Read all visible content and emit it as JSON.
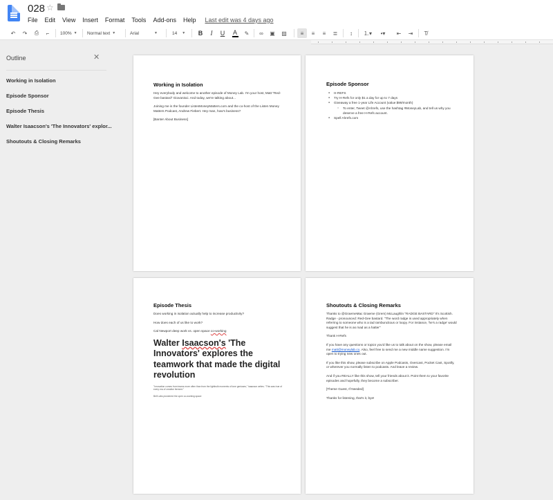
{
  "doc": {
    "title": "028",
    "star_icon": "star-icon",
    "folder_icon": "folder-icon"
  },
  "menu": {
    "items": [
      "File",
      "Edit",
      "View",
      "Insert",
      "Format",
      "Tools",
      "Add-ons",
      "Help"
    ],
    "last_edit": "Last edit was 4 days ago"
  },
  "toolbar": {
    "zoom": "100%",
    "style": "Normal text",
    "font": "Arial",
    "font_size": "14",
    "bold": "B",
    "italic": "I",
    "underline": "U",
    "text_color": "A"
  },
  "outline": {
    "title": "Outline",
    "items": [
      "Working in Isolation",
      "Episode Sponsor",
      "Episode Thesis",
      "Walter Isaacson's 'The Innovators' explor...",
      "Shoutouts & Closing Remarks"
    ]
  },
  "pages": {
    "p1": {
      "heading": "Working in Isolation",
      "para1": "Hey everybody and welcome to another episode of Money Lab. I'm your host, Matt \"Red-Gee bastard\" Giovanisci. And today, we're talking about...",
      "para2": "Joining me is the founder ListenMoneyMatters.com and the co-host of the Listen Money Matters Podcast, Andrew Fiebert. Hey man, how's business?",
      "para3": "[Banter About Business]"
    },
    "p2": {
      "heading": "Episode Sponsor",
      "bullets": [
        "H-REFS",
        "Try H-Refs for only $1 a day for up to 7 days",
        "Giveaway a free 1-year Life Account (value $99/month)",
        "To enter, Tweet @Ahrefs, use the hashtag #MoneyLab, and tell us why you deserve a free H-Refs account.",
        "Spell Ahrefs.com"
      ]
    },
    "p3": {
      "heading": "Episode Thesis",
      "para1": "Does working in isolation actually help to increase productivity?",
      "para2": "How does each of us like to work?",
      "para3_pre": "Cal Newport deep work vs. open space ",
      "para3_link": "co-working",
      "big_heading_pre": "Walter ",
      "big_heading_name": "Isaacson's",
      "big_heading_post": " 'The Innovators' explores the teamwork that made the digital revolution",
      "quote": "\"Innovation comes from teams more often than from the lightbulb moments of lone geniuses,\" Isaacson writes. \"This was true of every era of creative ferment.\"",
      "para4": "Bell Labs pioneered the open co-working space"
    },
    "p4": {
      "heading": "Shoutouts & Closing Remarks",
      "para1": "Thanks to @GraemeMac Graeme (Grem) McLaughlin \"RADGE BASTARD\" It's Scottish. Radge - pronounced: Red-Gee bastard. \"The word radge is used appropriately when referring to someone who is a tad rambunctious or loopy. For instance, 'he's a radge' would suggest that he is as mad as a hatter\"",
      "para2": "Thank H-Refs",
      "para3_pre": "If you have any questions or topics you'd like us to talk about on the show, please email me ",
      "para3_link": "matt@moneylab.co",
      "para3_post": ". Also, feel free to send me a new middle name suggestion. I'm open to trying new ones out.",
      "para4": "If you like this show, please subscribe on Apple Podcasts, Overcast, Pocket Cast, Spotify, or wherever you normally listen to podcasts. And leave a review.",
      "para5": "And if you REALLY like this show, tell your friends about it. Point them to your favorite episodes and hopefully, they become a subscriber.",
      "para6": "[Theme Guest, If Needed]",
      "para7": "Thanks for listening, that's it, bye!"
    }
  }
}
